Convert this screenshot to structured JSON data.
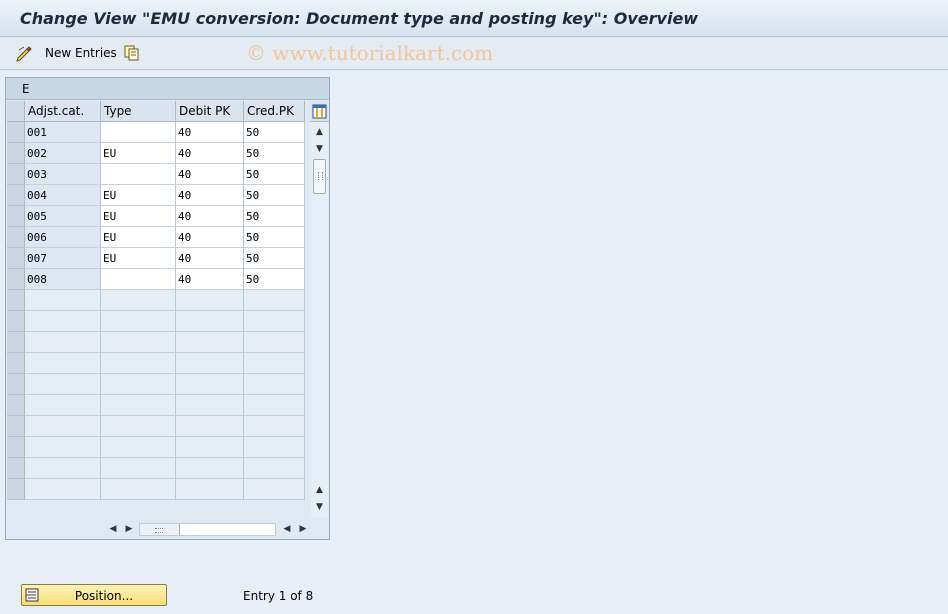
{
  "title": "Change View \"EMU conversion: Document type and posting key\": Overview",
  "toolbar": {
    "new_entries_label": "New Entries",
    "icons": [
      "edit-pencil-icon",
      "copy-entries-icon"
    ]
  },
  "watermark": "© www.tutorialkart.com",
  "table": {
    "tab_title": "E",
    "columns": [
      "Adjst.cat.",
      "Type",
      "Debit PK",
      "Cred.PK"
    ],
    "rows": [
      {
        "cat": "001",
        "type": "",
        "debit": "40",
        "cred": "50"
      },
      {
        "cat": "002",
        "type": "EU",
        "debit": "40",
        "cred": "50"
      },
      {
        "cat": "003",
        "type": "",
        "debit": "40",
        "cred": "50"
      },
      {
        "cat": "004",
        "type": "EU",
        "debit": "40",
        "cred": "50"
      },
      {
        "cat": "005",
        "type": "EU",
        "debit": "40",
        "cred": "50"
      },
      {
        "cat": "006",
        "type": "EU",
        "debit": "40",
        "cred": "50"
      },
      {
        "cat": "007",
        "type": "EU",
        "debit": "40",
        "cred": "50"
      },
      {
        "cat": "008",
        "type": "",
        "debit": "40",
        "cred": "50"
      }
    ]
  },
  "footer": {
    "position_button_label": "Position...",
    "entry_status": "Entry 1 of 8"
  },
  "colors": {
    "titlebar": "#d6e1ee",
    "position_button": "#f6dd78"
  }
}
